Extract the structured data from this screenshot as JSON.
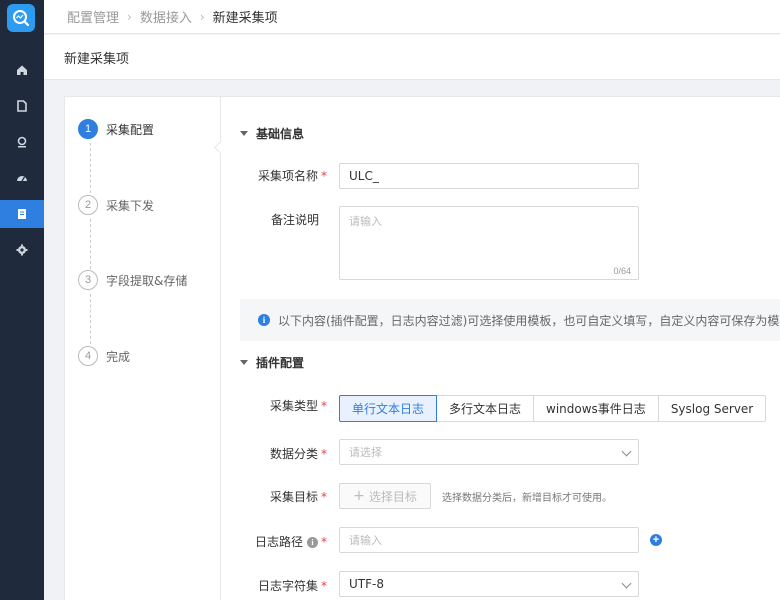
{
  "breadcrumb": {
    "items": [
      "配置管理",
      "数据接入",
      "新建采集项"
    ],
    "separator": "›"
  },
  "page": {
    "title": "新建采集项"
  },
  "steps": [
    {
      "num": "1",
      "label": "采集配置",
      "active": true
    },
    {
      "num": "2",
      "label": "采集下发",
      "active": false
    },
    {
      "num": "3",
      "label": "字段提取&存储",
      "active": false
    },
    {
      "num": "4",
      "label": "完成",
      "active": false
    }
  ],
  "basic": {
    "section_title": "基础信息",
    "name_label": "采集项名称",
    "name_value": "ULC_",
    "remark_label": "备注说明",
    "remark_placeholder": "请输入",
    "remark_counter": "0/64"
  },
  "notice": {
    "icon": "info-icon",
    "text": "以下内容(插件配置，日志内容过滤)可选择使用模板，也可自定义填写，自定义内容可保存为模板。"
  },
  "plugin": {
    "section_title": "插件配置",
    "type_label": "采集类型",
    "type_options": [
      "单行文本日志",
      "多行文本日志",
      "windows事件日志",
      "Syslog Server"
    ],
    "type_selected": "单行文本日志",
    "category_label": "数据分类",
    "category_placeholder": "请选择",
    "target_label": "采集目标",
    "target_button": "选择目标",
    "target_hint": "选择数据分类后，新增目标才可使用。",
    "path_label": "日志路径",
    "path_placeholder": "请输入",
    "charset_label": "日志字符集",
    "charset_value": "UTF-8"
  },
  "colors": {
    "primary": "#2f7fe0",
    "nav_bg": "#1f2a3d",
    "required": "#e64545"
  }
}
